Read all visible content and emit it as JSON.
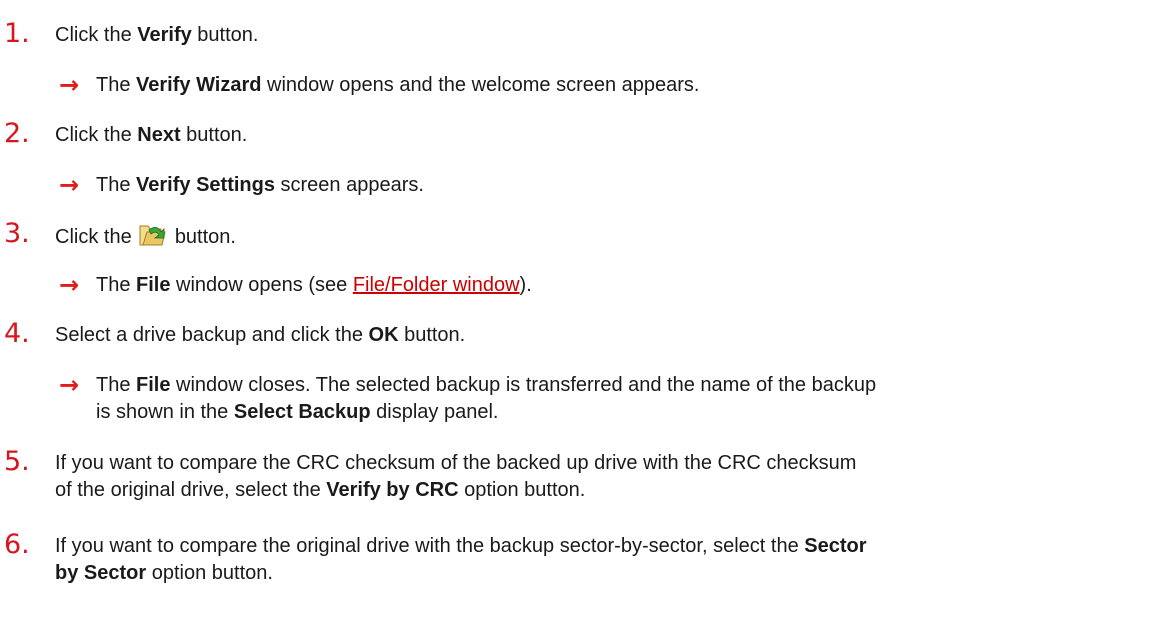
{
  "steps": [
    {
      "number": "1.",
      "instruction": [
        "Click the ",
        "Verify",
        " button."
      ],
      "result": [
        "The ",
        "Verify Wizard",
        " window opens and the welcome screen appears."
      ]
    },
    {
      "number": "2.",
      "instruction": [
        "Click the ",
        "Next",
        " button."
      ],
      "result": [
        "The ",
        "Verify Settings",
        " screen appears."
      ]
    },
    {
      "number": "3.",
      "instruction": [
        "Click the ",
        "button."
      ],
      "icon": "folder-arrow-icon",
      "result": [
        "The ",
        "File",
        " window opens (see ",
        "File/Folder window",
        ")."
      ]
    },
    {
      "number": "4.",
      "instruction": [
        "Select a drive backup and click the ",
        "OK",
        " button."
      ],
      "result_line1": [
        "The ",
        "File",
        " window closes. The selected backup is transferred and the name of the backup"
      ],
      "result_line2": [
        "is shown in the ",
        "Select Backup",
        " display panel."
      ]
    },
    {
      "number": "5.",
      "line1": "If you want to compare the CRC checksum of the backed up drive with the CRC checksum",
      "line2": [
        "of the original drive, select the ",
        "Verify by CRC",
        " option button."
      ]
    },
    {
      "number": "6.",
      "line1": [
        "If you want to compare the original drive with the backup sector-by-sector, select the ",
        "Sector"
      ],
      "line2": [
        "by Sector",
        " option button."
      ]
    }
  ],
  "arrow_glyph": "→",
  "colors": {
    "number": "#d8141d",
    "arrow": "#e01d1d",
    "link": "#cc0000",
    "text": "#1a1a1a"
  }
}
